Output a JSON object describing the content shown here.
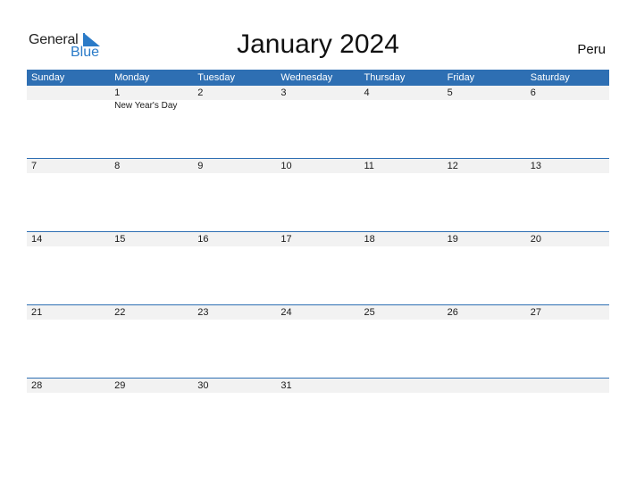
{
  "logo": {
    "general": "General",
    "blue": "Blue"
  },
  "title": "January 2024",
  "country": "Peru",
  "colors": {
    "accent": "#2e6fb3",
    "logo_blue": "#2b7bc8",
    "day_row_bg": "#f2f2f2"
  },
  "weekdays": [
    "Sunday",
    "Monday",
    "Tuesday",
    "Wednesday",
    "Thursday",
    "Friday",
    "Saturday"
  ],
  "weeks": [
    {
      "days": [
        "",
        "1",
        "2",
        "3",
        "4",
        "5",
        "6"
      ],
      "events": [
        "",
        "New Year's Day",
        "",
        "",
        "",
        "",
        ""
      ]
    },
    {
      "days": [
        "7",
        "8",
        "9",
        "10",
        "11",
        "12",
        "13"
      ],
      "events": [
        "",
        "",
        "",
        "",
        "",
        "",
        ""
      ]
    },
    {
      "days": [
        "14",
        "15",
        "16",
        "17",
        "18",
        "19",
        "20"
      ],
      "events": [
        "",
        "",
        "",
        "",
        "",
        "",
        ""
      ]
    },
    {
      "days": [
        "21",
        "22",
        "23",
        "24",
        "25",
        "26",
        "27"
      ],
      "events": [
        "",
        "",
        "",
        "",
        "",
        "",
        ""
      ]
    },
    {
      "days": [
        "28",
        "29",
        "30",
        "31",
        "",
        "",
        ""
      ],
      "events": [
        "",
        "",
        "",
        "",
        "",
        "",
        ""
      ]
    }
  ]
}
